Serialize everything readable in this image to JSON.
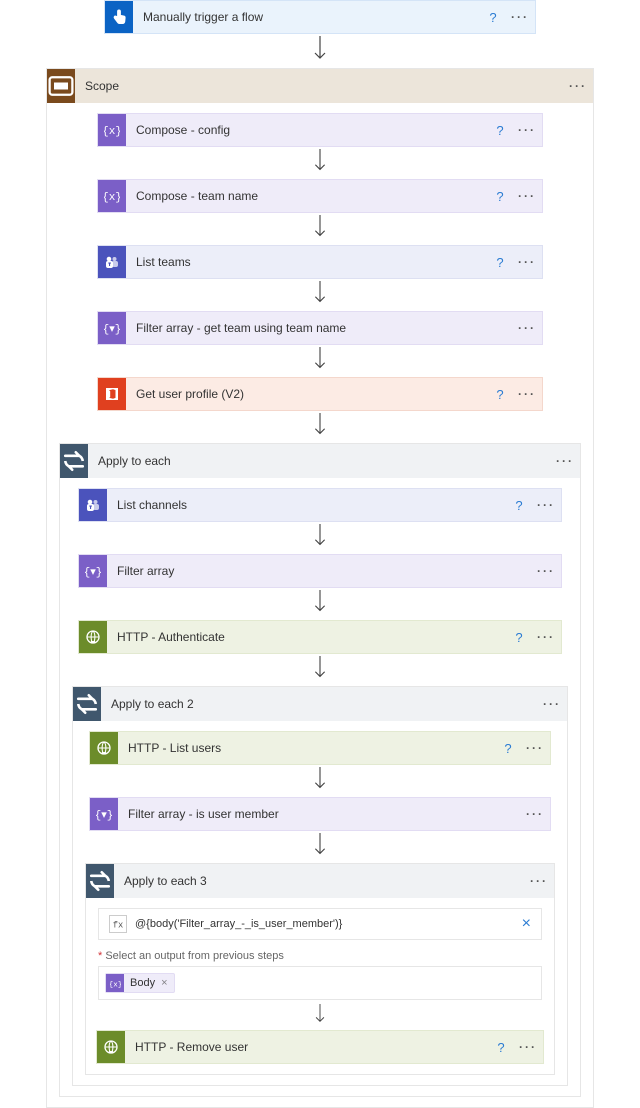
{
  "trigger": {
    "label": "Manually trigger a flow"
  },
  "scope": {
    "label": "Scope",
    "steps": {
      "compose_config": "Compose - config",
      "compose_teamname": "Compose - team name",
      "list_teams": "List teams",
      "filter_team": "Filter array - get team using team name",
      "get_profile": "Get user profile (V2)"
    },
    "apply1": {
      "label": "Apply to each",
      "steps": {
        "list_channels": "List channels",
        "filter_array": "Filter array",
        "http_auth": "HTTP - Authenticate"
      },
      "apply2": {
        "label": "Apply to each 2",
        "steps": {
          "http_list_users": "HTTP - List users",
          "filter_is_member": "Filter array - is user member"
        },
        "apply3": {
          "label": "Apply to each 3",
          "expression": "@{body('Filter_array_-_is_user_member')}",
          "field_label": "Select an output from previous steps",
          "token": "Body",
          "steps": {
            "http_remove": "HTTP - Remove user"
          }
        }
      }
    }
  },
  "ui": {
    "help": "?",
    "more": "···",
    "close": "×",
    "required": "*"
  }
}
